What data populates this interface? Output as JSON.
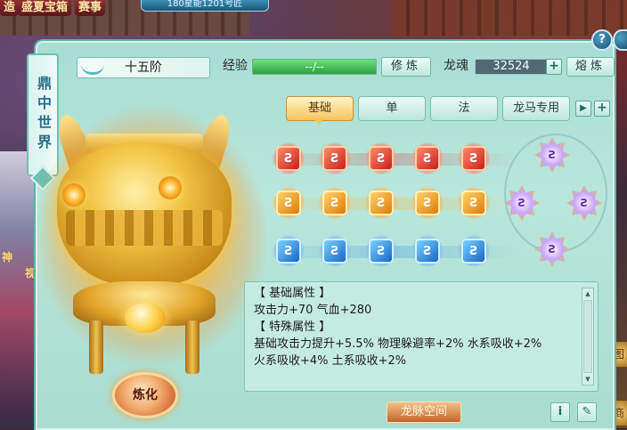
{
  "background": {
    "top_tabs": [
      "造",
      "盛夏宝箱",
      "赛事"
    ],
    "top_banner": "180星能1201号匠",
    "left_side_text": [
      "神",
      "视"
    ],
    "right_icon_labels": [
      "图",
      "商"
    ]
  },
  "panel": {
    "vertical_title": "鼎中世界",
    "help_icon_label": "?",
    "stage_label": "十五阶",
    "exp_label": "经验",
    "exp_value": "--/--",
    "exp_progress": 1.0,
    "cultivate_button": "修炼",
    "dragon_soul_label": "龙魂",
    "dragon_soul_value": "32524",
    "smelt_button": "熔炼",
    "plus_label": "+"
  },
  "tabs": [
    {
      "label": "基础",
      "active": true
    },
    {
      "label": "单",
      "active": false
    },
    {
      "label": "法",
      "active": false
    },
    {
      "label": "龙马专用",
      "active": false
    }
  ],
  "tab_next_arrow": "▶",
  "gem_symbol": "Ƨ",
  "gems": {
    "red_count": 5,
    "orange_count": 5,
    "blue_count": 5,
    "star_count": 4
  },
  "refine_button": "炼化",
  "attributes": {
    "lines": [
      "【 基础属性 】",
      "攻击力+70  气血+280",
      "【 特殊属性 】",
      "基础攻击力提升+5.5%  物理躲避率+2%  水系吸收+2%",
      "火系吸收+4%  土系吸收+2%"
    ],
    "scroll_up": "▲",
    "scroll_down": "▼"
  },
  "bottom": {
    "space_button": "龙脉空间",
    "info_button": "i",
    "edit_button": "✎"
  },
  "colors": {
    "panel_bg": "#b9e6dc",
    "active_tab": "#f4c45a",
    "exp_fill": "#2ea043",
    "refine_btn": "#c24a1a"
  }
}
